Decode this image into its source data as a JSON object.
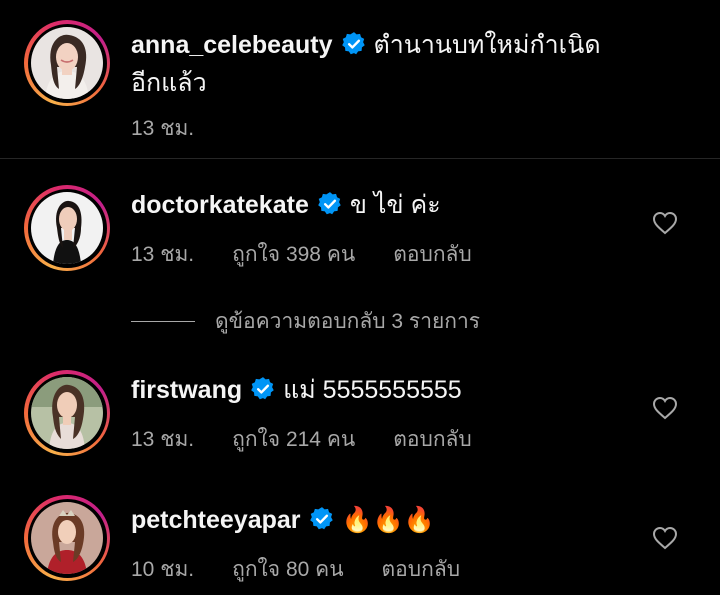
{
  "caption": {
    "username": "anna_celebeauty",
    "text_line1": "ตำนานบทใหม่กำเนิด",
    "text_line2": "อีกแล้ว",
    "time": "13 ชม."
  },
  "comments": [
    {
      "username": "doctorkatekate",
      "text": "ข ไข่ ค่ะ",
      "time": "13 ชม.",
      "likes": "ถูกใจ 398 คน",
      "reply": "ตอบกลับ",
      "view_replies": "ดูข้อความตอบกลับ 3 รายการ"
    },
    {
      "username": "firstwang",
      "text": "แม่ 5555555555",
      "time": "13 ชม.",
      "likes": "ถูกใจ 214 คน",
      "reply": "ตอบกลับ"
    },
    {
      "username": "petchteeyapar",
      "text": "🔥🔥🔥",
      "time": "10 ชม.",
      "likes": "ถูกใจ 80 คน",
      "reply": "ตอบกลับ"
    }
  ],
  "colors": {
    "background": "#000000",
    "text_primary": "#f5f5f5",
    "text_secondary": "#a8a8a8",
    "verified_blue": "#0095f6",
    "divider": "#262626"
  },
  "icons": [
    "verified-badge-icon",
    "heart-outline-icon",
    "fire-emoji"
  ]
}
